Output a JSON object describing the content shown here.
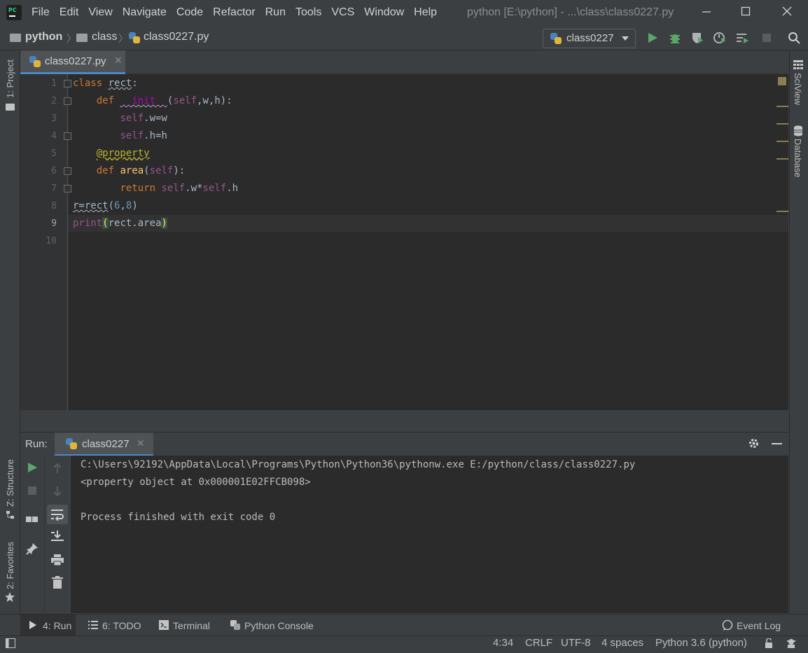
{
  "app": {
    "logo_text": "PC",
    "window_title": "python [E:\\python] - ...\\class\\class0227.py"
  },
  "menu": [
    "File",
    "Edit",
    "View",
    "Navigate",
    "Code",
    "Refactor",
    "Run",
    "Tools",
    "VCS",
    "Window",
    "Help"
  ],
  "breadcrumb": {
    "project": "python",
    "folder": "class",
    "file": "class0227.py"
  },
  "run_config": {
    "name": "class0227"
  },
  "left_stripe": {
    "project_tab": "1: Project",
    "structure_tab": "Z: Structure",
    "favorites_tab": "2: Favorites"
  },
  "right_stripe": {
    "sciview_tab": "SciView",
    "database_tab": "Database"
  },
  "editor": {
    "tab_label": "class0227.py",
    "line_numbers": [
      "1",
      "2",
      "3",
      "4",
      "5",
      "6",
      "7",
      "8",
      "9",
      "10"
    ]
  },
  "run_panel": {
    "label": "Run:",
    "tab_label": "class0227",
    "output": [
      "C:\\Users\\92192\\AppData\\Local\\Programs\\Python\\Python36\\pythonw.exe E:/python/class/class0227.py",
      "<property object at 0x000001E02FFCB098>",
      "",
      "Process finished with exit code 0"
    ]
  },
  "bottom_tabs": {
    "run": "4: Run",
    "todo": "6: TODO",
    "terminal": "Terminal",
    "python_console": "Python Console",
    "event_log": "Event Log"
  },
  "status": {
    "position": "4:34",
    "line_sep": "CRLF",
    "encoding": "UTF-8",
    "indent": "4 spaces",
    "interpreter": "Python 3.6 (python)"
  },
  "colors": {
    "run_green": "#59a869",
    "accent_blue": "#4a88c7",
    "keyword": "#cc7832",
    "self": "#94558d",
    "number": "#6897bb",
    "decorator": "#bbb529"
  }
}
